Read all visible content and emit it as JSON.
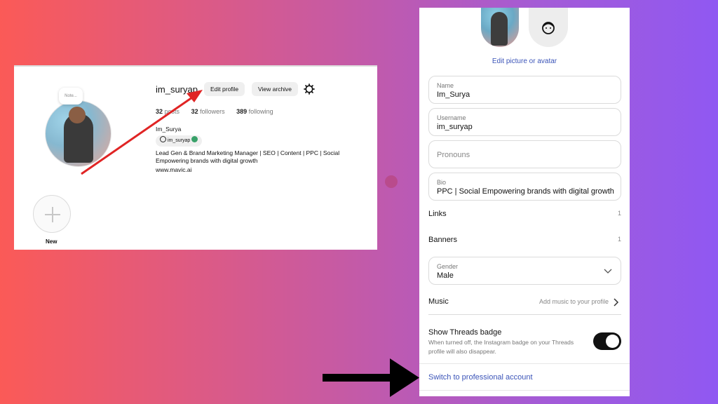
{
  "desktop": {
    "note_label": "Note...",
    "username": "im_suryap",
    "edit_profile_label": "Edit profile",
    "view_archive_label": "View archive",
    "stats": {
      "posts_count": "32",
      "posts_label": "posts",
      "followers_count": "32",
      "followers_label": "followers",
      "following_count": "389",
      "following_label": "following"
    },
    "display_name": "Im_Surya",
    "threads_handle": "im_suryap",
    "bio_line1": "Lead Gen & Brand Marketing Manager | SEO | Content | PPC | Social",
    "bio_line2": "Empowering brands with digital growth",
    "website": "www.mavic.ai",
    "new_highlight_label": "New"
  },
  "mobile": {
    "edit_picture_label": "Edit picture or avatar",
    "name": {
      "label": "Name",
      "value": "Im_Surya"
    },
    "username": {
      "label": "Username",
      "value": "im_suryap"
    },
    "pronouns": {
      "placeholder": "Pronouns"
    },
    "bio": {
      "label": "Bio",
      "value": "PPC | Social Empowering brands with digital growth"
    },
    "links": {
      "label": "Links",
      "count": "1"
    },
    "banners": {
      "label": "Banners",
      "count": "1"
    },
    "gender": {
      "label": "Gender",
      "value": "Male"
    },
    "music": {
      "label": "Music",
      "hint": "Add music to your profile"
    },
    "threads_badge": {
      "title": "Show Threads badge",
      "description": "When turned off, the Instagram badge on your Threads profile will also disappear.",
      "enabled": true
    },
    "switch_professional_label": "Switch to professional account"
  },
  "colors": {
    "link_blue": "#3b54b8",
    "annotation_red": "#e02424",
    "annotation_black": "#000000",
    "toggle_on": "#111111"
  }
}
